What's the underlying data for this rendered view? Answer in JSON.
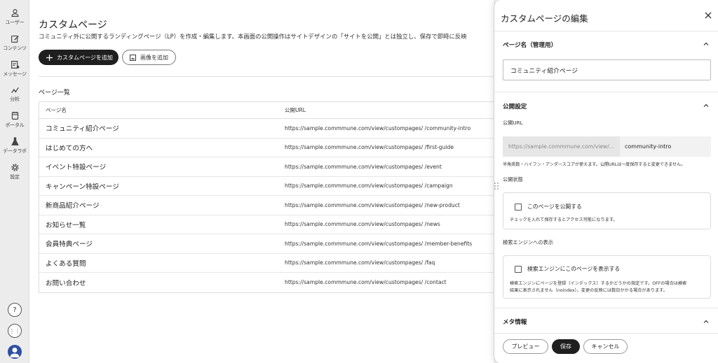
{
  "sidebar": {
    "items": [
      {
        "label": "ユーザー",
        "icon": "user-icon"
      },
      {
        "label": "コンテンツ",
        "icon": "edit-icon"
      },
      {
        "label": "メッセージ",
        "icon": "message-icon"
      },
      {
        "label": "分析",
        "icon": "analytics-icon"
      },
      {
        "label": "ポータル",
        "icon": "portal-icon"
      },
      {
        "label": "データラボ",
        "icon": "flask-icon"
      },
      {
        "label": "設定",
        "icon": "gear-icon"
      }
    ],
    "help_icon": "?",
    "apps_icon": "⋮⋮"
  },
  "main": {
    "title": "カスタムページ",
    "description": "コミュニティ外に公開するランディングページ（LP）を作成・編集します。本画面の公開操作はサイトデザインの「サイトを公開」とは独立し、保存で即時に反映",
    "add_page_label": "カスタムページを追加",
    "add_image_label": "画像を追加",
    "list_title": "ページ一覧",
    "columns": [
      "ページ名",
      "公開URL"
    ],
    "rows": [
      {
        "name": "コミュニティ紹介ページ",
        "url": "https://sample.commmune.com/view/custompages/  /community-intro"
      },
      {
        "name": "はじめての方へ",
        "url": "https://sample.commmune.com/view/custompages/  /first-guide"
      },
      {
        "name": "イベント特設ページ",
        "url": "https://sample.commmune.com/view/custompages/  /event"
      },
      {
        "name": "キャンペーン特設ページ",
        "url": "https://sample.commmune.com/view/custompages/  /campaign"
      },
      {
        "name": "新商品紹介ページ",
        "url": "https://sample.commmune.com/view/custompages/  /new-product"
      },
      {
        "name": "お知らせ一覧",
        "url": "https://sample.commmune.com/view/custompages/  /news"
      },
      {
        "name": "会員特典ページ",
        "url": "https://sample.commmune.com/view/custompages/  /member-benefits"
      },
      {
        "name": "よくある質問",
        "url": "https://sample.commmune.com/view/custompages/  /faq"
      },
      {
        "name": "お問い合わせ",
        "url": "https://sample.commmune.com/view/custompages/  /contact"
      }
    ]
  },
  "drawer": {
    "title": "カスタムページの編集",
    "page_name_section": "ページ名（管理用）",
    "page_name_value": "コミュニティ紹介ページ",
    "publish_section": "公開設定",
    "url_label": "公開URL",
    "url_prefix": "https://sample.commmune.com/view/...",
    "url_slug": "community-intro",
    "url_help": "半角英数・ハイフン・アンダースコアが使えます。公開URLは一度保存すると変更できません。",
    "status_label": "公開状態",
    "publish_checkbox": "このページを公開する",
    "publish_help": "チェックを入れて保存するとアクセス可能になります。",
    "search_label": "検索エンジンへの表示",
    "search_checkbox": "検索エンジンにこのページを表示する",
    "search_help_1": "検索エンジンにページを登録（インデックス）するかどうかの指定です。OFFの場合は検索",
    "search_help_2": "結果に表示されません（noindex）。変更の反映には数日かかる場合があります。",
    "meta_section": "メタ情報",
    "preview_label": "プレビュー",
    "save_label": "保存",
    "cancel_label": "キャンセル"
  },
  "colors": {
    "primary": "#1f1f1f",
    "avatar": "#2e4fa3"
  }
}
